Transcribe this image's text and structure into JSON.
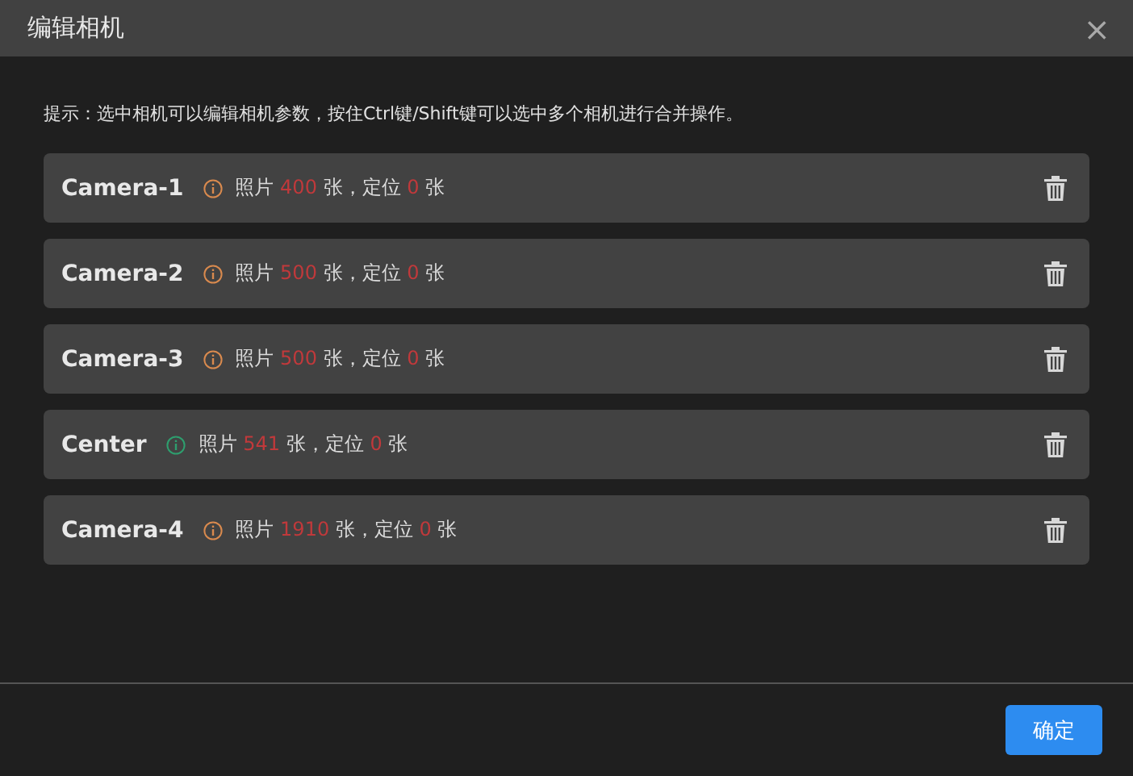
{
  "dialog": {
    "title": "编辑相机",
    "close": "×"
  },
  "hint": "提示：选中相机可以编辑相机参数，按住Ctrl键/Shift键可以选中多个相机进行合并操作。",
  "cameras": [
    {
      "name": "Camera-1",
      "color": "#d98a4e",
      "photos_label": "照片",
      "photos": "400",
      "middle": "张，定位",
      "located": "0",
      "unit": "张"
    },
    {
      "name": "Camera-2",
      "color": "#d98a4e",
      "photos_label": "照片",
      "photos": "500",
      "middle": "张，定位",
      "located": "0",
      "unit": "张"
    },
    {
      "name": "Camera-3",
      "color": "#d98a4e",
      "photos_label": "照片",
      "photos": "500",
      "middle": "张，定位",
      "located": "0",
      "unit": "张"
    },
    {
      "name": "Center",
      "color": "#2e9e6e",
      "photos_label": "照片",
      "photos": "541",
      "middle": "张，定位",
      "located": "0",
      "unit": "张"
    },
    {
      "name": "Camera-4",
      "color": "#d98a4e",
      "photos_label": "照片",
      "photos": "1910",
      "middle": "张，定位",
      "located": "0",
      "unit": "张"
    }
  ],
  "confirm": "确定"
}
